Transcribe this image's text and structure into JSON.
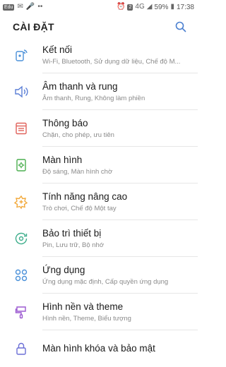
{
  "status_bar": {
    "left_badge": "Edu",
    "sim_badge": "2",
    "network": "4G",
    "battery": "59%",
    "time": "17:38"
  },
  "header": {
    "title": "CÀI ĐẶT"
  },
  "settings": [
    {
      "title": "Kết nối",
      "subtitle": "Wi-Fi, Bluetooth, Sử dụng dữ liệu, Chế độ M...",
      "icon": "connections-icon",
      "color": "#4a90d9"
    },
    {
      "title": "Âm thanh và rung",
      "subtitle": "Âm thanh, Rung, Không làm phiền",
      "icon": "sound-icon",
      "color": "#5b7fd6"
    },
    {
      "title": "Thông báo",
      "subtitle": "Chặn, cho phép, ưu tiên",
      "icon": "notifications-icon",
      "color": "#e0625b"
    },
    {
      "title": "Màn hình",
      "subtitle": "Độ sáng, Màn hình chờ",
      "icon": "display-icon",
      "color": "#4caf50"
    },
    {
      "title": "Tính năng nâng cao",
      "subtitle": "Trò chơi, Chế độ Một tay",
      "icon": "advanced-features-icon",
      "color": "#f2a93b"
    },
    {
      "title": "Bảo trì thiết bị",
      "subtitle": "Pin, Lưu trữ, Bộ nhớ",
      "icon": "device-maintenance-icon",
      "color": "#3fae8c"
    },
    {
      "title": "Ứng dụng",
      "subtitle": "Ứng dụng mặc định, Cấp quyền ứng dụng",
      "icon": "apps-icon",
      "color": "#4a90d9"
    },
    {
      "title": "Hình nền và theme",
      "subtitle": "Hình nền, Theme, Biểu tượng",
      "icon": "wallpapers-themes-icon",
      "color": "#9b59d0"
    },
    {
      "title": "Màn hình khóa và bảo mật",
      "subtitle": "",
      "icon": "lock-screen-icon",
      "color": "#6b6fd6"
    }
  ]
}
